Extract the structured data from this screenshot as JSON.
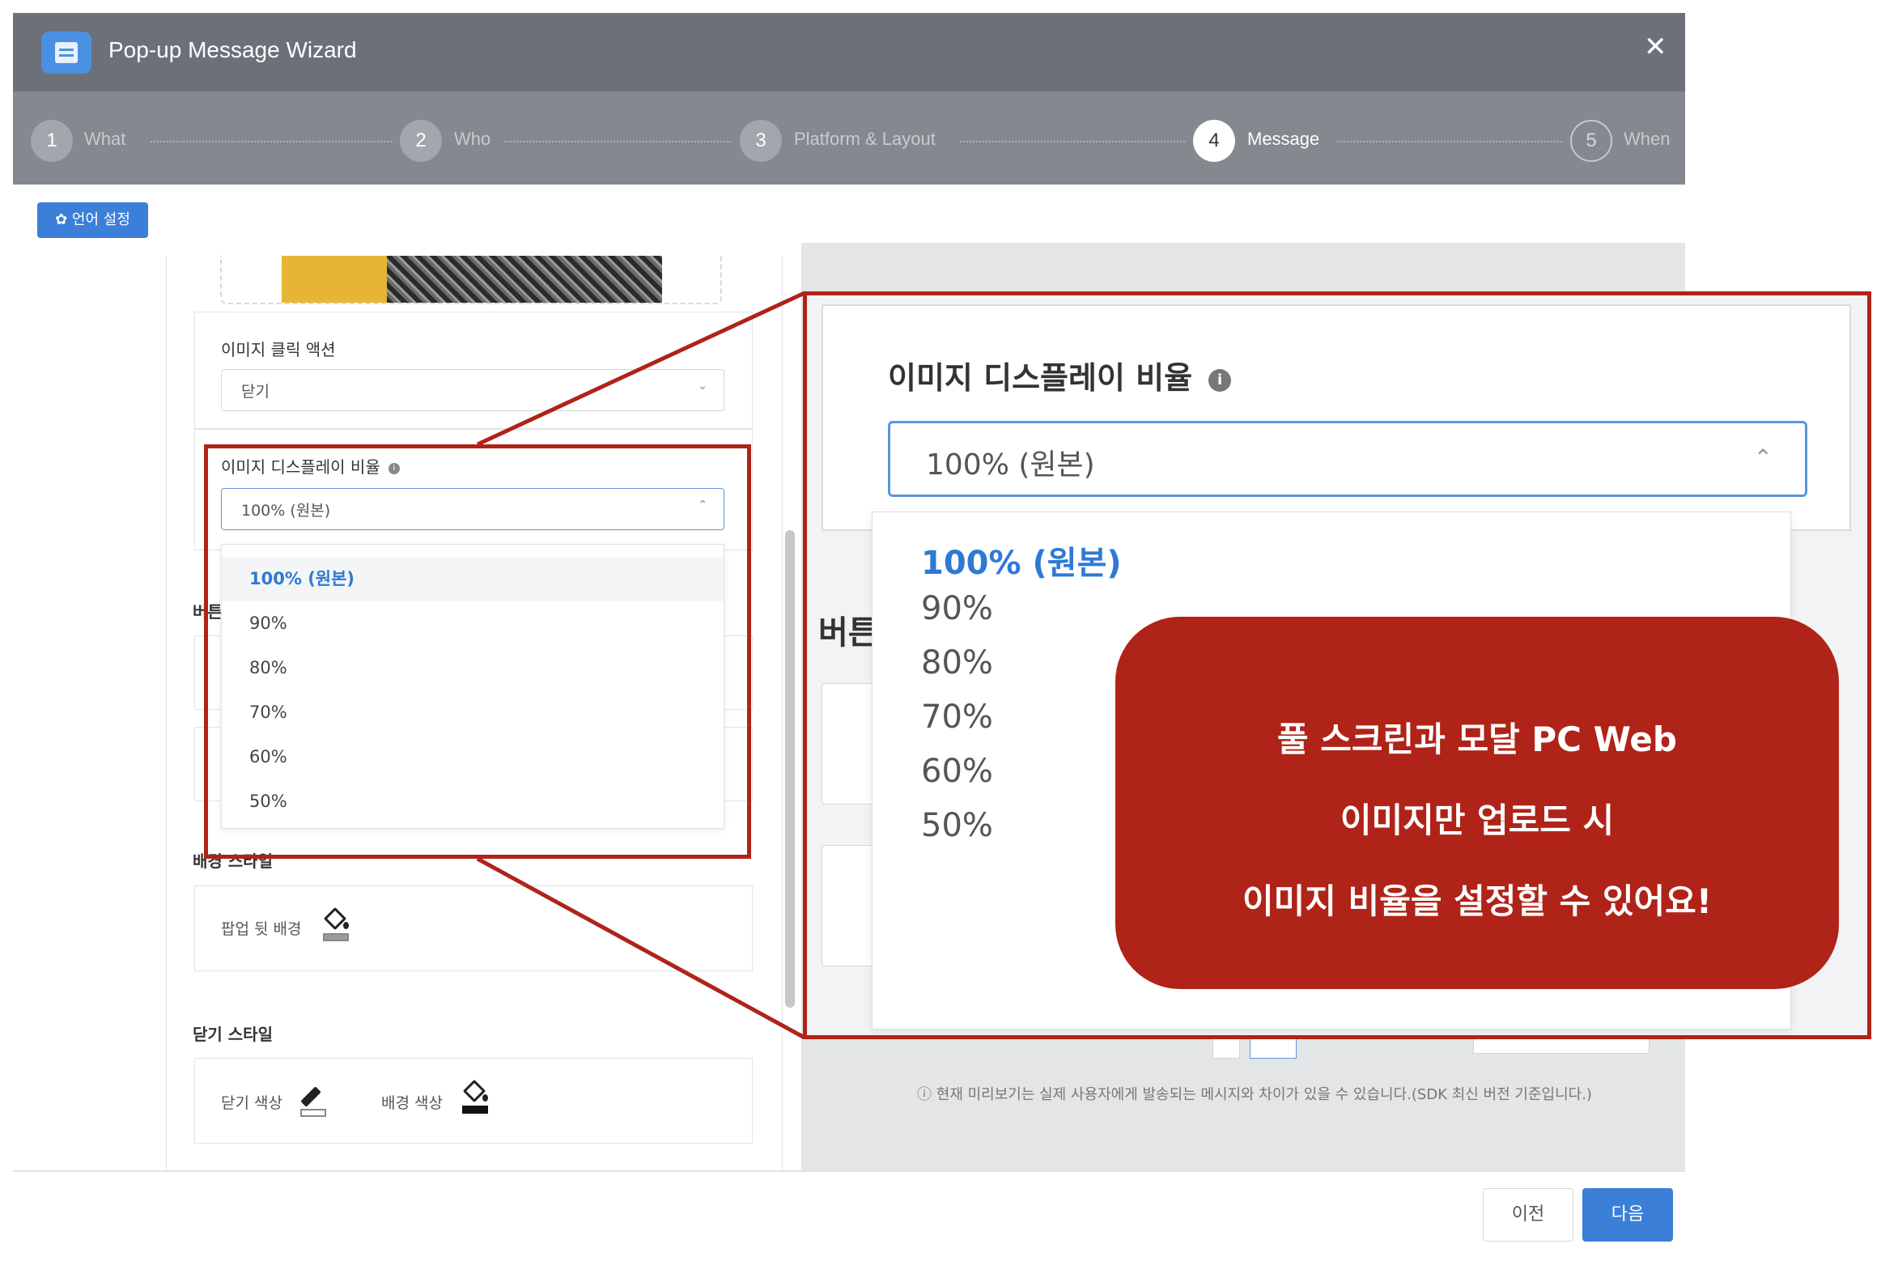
{
  "window": {
    "title": "Pop-up Message Wizard",
    "close_symbol": "✕",
    "app_icon": "message-window-icon"
  },
  "steps": [
    {
      "num": "1",
      "label": "What",
      "state": "done"
    },
    {
      "num": "2",
      "label": "Who",
      "state": "done"
    },
    {
      "num": "3",
      "label": "Platform & Layout",
      "state": "done"
    },
    {
      "num": "4",
      "label": "Message",
      "state": "active"
    },
    {
      "num": "5",
      "label": "When",
      "state": "upcoming"
    }
  ],
  "lang_button": {
    "icon": "gear-icon",
    "label": "✿ 언어 설정"
  },
  "left": {
    "click_action": {
      "label": "이미지 클릭 액션",
      "value": "닫기"
    },
    "display_ratio": {
      "label": "이미지 디스플레이 비율",
      "value": "100% (원본)"
    },
    "options": [
      "100% (원본)",
      "90%",
      "80%",
      "70%",
      "60%",
      "50%"
    ],
    "button_partial": "버튼",
    "bg_style": {
      "label": "배경 스타일",
      "item": "팝업 뒷 배경"
    },
    "close_style": {
      "label": "닫기 스타일",
      "close_color": "닫기 색상",
      "bg_color": "배경 색상"
    }
  },
  "preview": {
    "note": "ⓘ 현재 미리보기는 실제 사용자에게 발송되는 메시지와 차이가 있을 수 있습니다.(SDK 최신 버전 기준입니다.)"
  },
  "zoom": {
    "label": "이미지 디스플레이 비율",
    "value": "100% (원본)",
    "options": [
      "100% (원본)",
      "90%",
      "80%",
      "70%",
      "60%",
      "50%"
    ],
    "side_text": "버튼"
  },
  "callout": {
    "lines": [
      "풀 스크린과 모달 PC Web",
      "이미지만 업로드 시",
      "이미지 비율을 설정할 수 있어요!"
    ],
    "color": "#b02318"
  },
  "footer": {
    "prev": "이전",
    "next": "다음"
  },
  "colors": {
    "accent": "#3b7fd8",
    "header": "#6b7079",
    "stepper": "#84888f",
    "highlight": "#b02318",
    "selected_text": "#2f79d6"
  }
}
